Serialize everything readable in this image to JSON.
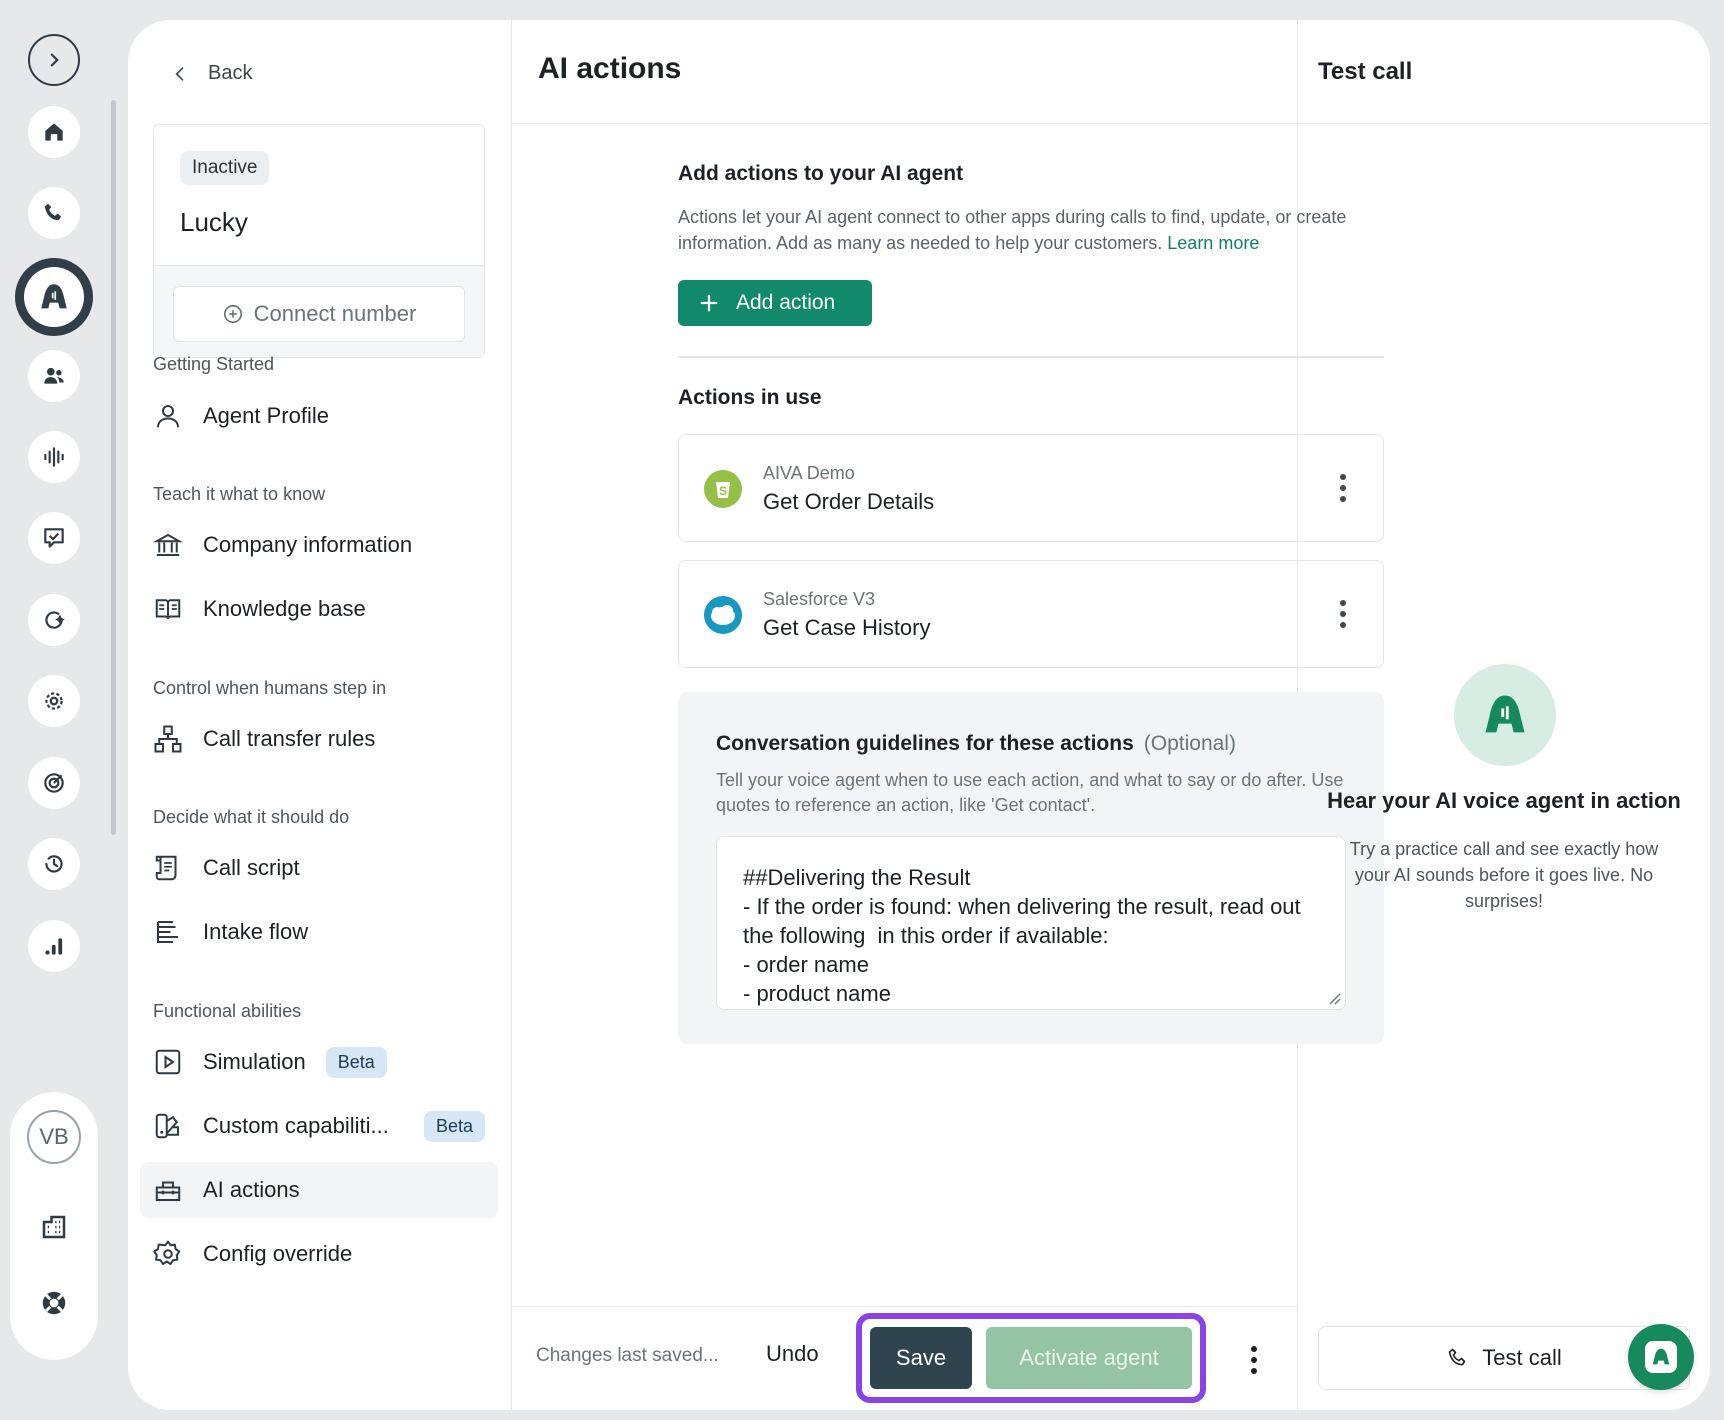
{
  "nav": {
    "back_label": "Back",
    "agent": {
      "status": "Inactive",
      "name": "Lucky",
      "connect_label": "Connect number"
    },
    "sections": [
      {
        "label": "Getting Started"
      },
      {
        "label": "Teach it what to know"
      },
      {
        "label": "Control when humans step in"
      },
      {
        "label": "Decide what it should do"
      },
      {
        "label": "Functional abilities"
      }
    ],
    "items": [
      {
        "label": "Agent Profile",
        "icon": "person-icon"
      },
      {
        "label": "Company information",
        "icon": "bank-icon"
      },
      {
        "label": "Knowledge base",
        "icon": "book-icon"
      },
      {
        "label": "Call transfer rules",
        "icon": "hierarchy-icon"
      },
      {
        "label": "Call script",
        "icon": "script-icon"
      },
      {
        "label": "Intake flow",
        "icon": "flow-icon"
      },
      {
        "label": "Simulation",
        "icon": "play-icon",
        "badge": "Beta"
      },
      {
        "label": "Custom capabiliti...",
        "icon": "palette-icon",
        "badge": "Beta"
      },
      {
        "label": "AI actions",
        "icon": "toolbox-icon",
        "active": true
      },
      {
        "label": "Config override",
        "icon": "gear-icon"
      }
    ]
  },
  "main": {
    "title": "AI actions",
    "add_section": {
      "heading": "Add actions to your AI agent",
      "description": "Actions let your AI agent connect to other apps during calls to find, update, or create information. Add as many as needed to help your customers. ",
      "learn_more": "Learn more",
      "add_button": "Add action"
    },
    "in_use_heading": "Actions in use",
    "actions": [
      {
        "source": "AIVA Demo",
        "name": "Get Order Details",
        "logo": "shopify-icon"
      },
      {
        "source": "Salesforce V3",
        "name": "Get Case History",
        "logo": "salesforce-icon"
      }
    ],
    "guidelines": {
      "title": "Conversation guidelines for these actions",
      "optional": "(Optional)",
      "description": "Tell your voice agent when to use each action, and what to say or do after. Use quotes to reference an action, like 'Get contact'.",
      "text": "##Delivering the Result\n- If the order is found: when delivering the result, read out the following  in this order if available:\n- order name\n- product name"
    },
    "footer": {
      "saved_text": "Changes last saved...",
      "undo": "Undo",
      "save": "Save",
      "activate": "Activate agent"
    }
  },
  "right_panel": {
    "title": "Test call",
    "hero_title": "Hear your AI voice agent in action",
    "hero_desc": "Try a practice call and see exactly how your AI sounds before it goes live. No surprises!",
    "test_call_button": "Test call"
  },
  "rail": {
    "avatar_initials": "VB"
  },
  "colors": {
    "accent_green": "#118a6c",
    "save_dark": "#304450",
    "activate_disabled": "#94c4a4",
    "highlight_purple": "#8a44e6",
    "beta_bg": "#d6e7f7"
  }
}
